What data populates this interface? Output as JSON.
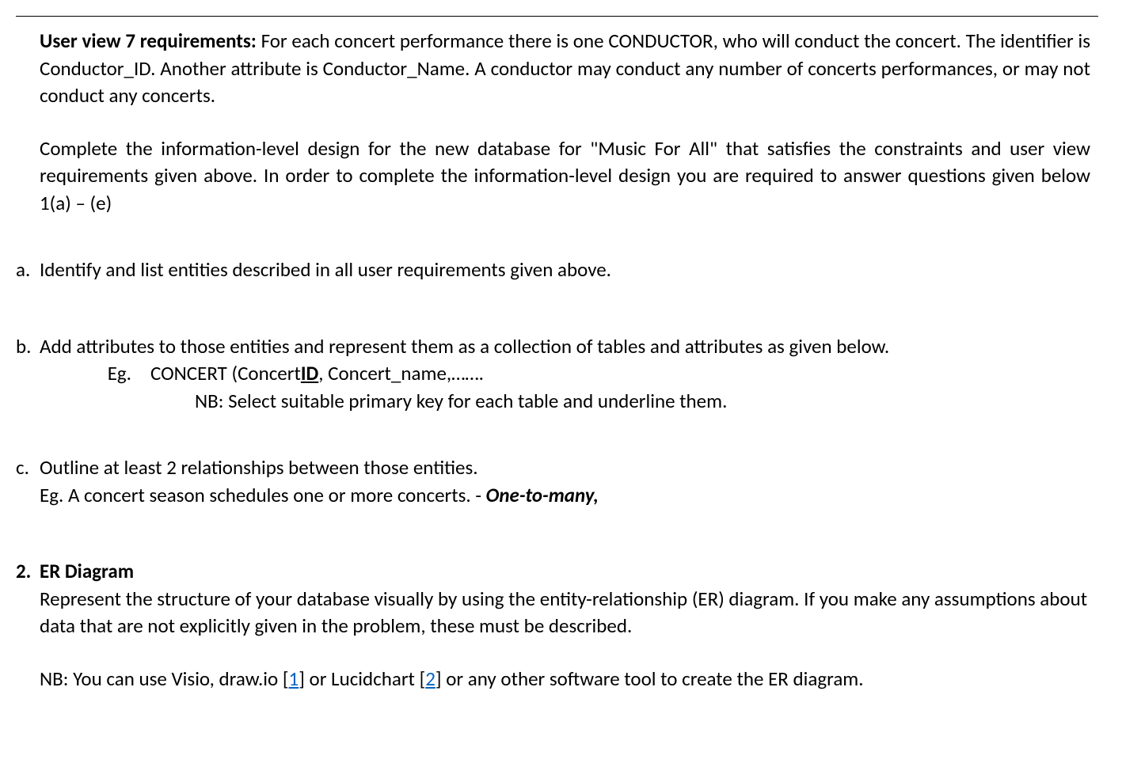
{
  "intro": {
    "para1_bold_lead": "User view 7 requirements:",
    "para1_rest": "  For each concert performance there is one CONDUCTOR, who will conduct the concert.  The identifier is Conductor_ID.  Another attribute is Conductor_Name. A conductor may conduct any number of concerts performances, or may not conduct any concerts.",
    "para2": "Complete the information-level design for the new database for \"Music For All\" that satisfies the constraints and user view requirements given above. In order to complete the information-level design you are required to answer questions given below 1(a) – (e)"
  },
  "items": {
    "a": {
      "marker": "a.",
      "text": "Identify and list entities described in all user requirements given above."
    },
    "b": {
      "marker": "b.",
      "text": "Add attributes to those entities and represent them as a collection of tables and attributes as given below.",
      "eg_label": "Eg.",
      "eg_pre": "CONCERT (Concert",
      "eg_underline": "ID",
      "eg_post": ", Concert_name,…….",
      "nb": "NB: Select suitable primary key for each table and underline them."
    },
    "c": {
      "marker": "c.",
      "text": "Outline at least 2 relationships between those entities.",
      "eg_pre": "Eg. A concert season schedules one or more concerts. - ",
      "eg_bold": "One-to-many,"
    },
    "q2": {
      "marker": "2.",
      "heading": "ER Diagram",
      "para": "Represent the structure of your database visually by using the entity-relationship (ER) diagram.  If you make any assumptions about data that are not explicitly given in the problem, these must be described.",
      "nb_pre": "NB: You can use Visio, draw.io [",
      "link1": "1",
      "nb_mid1": "] or Lucidchart  [",
      "link2": "2",
      "nb_post": "] or any other software tool  to create the ER diagram."
    }
  }
}
